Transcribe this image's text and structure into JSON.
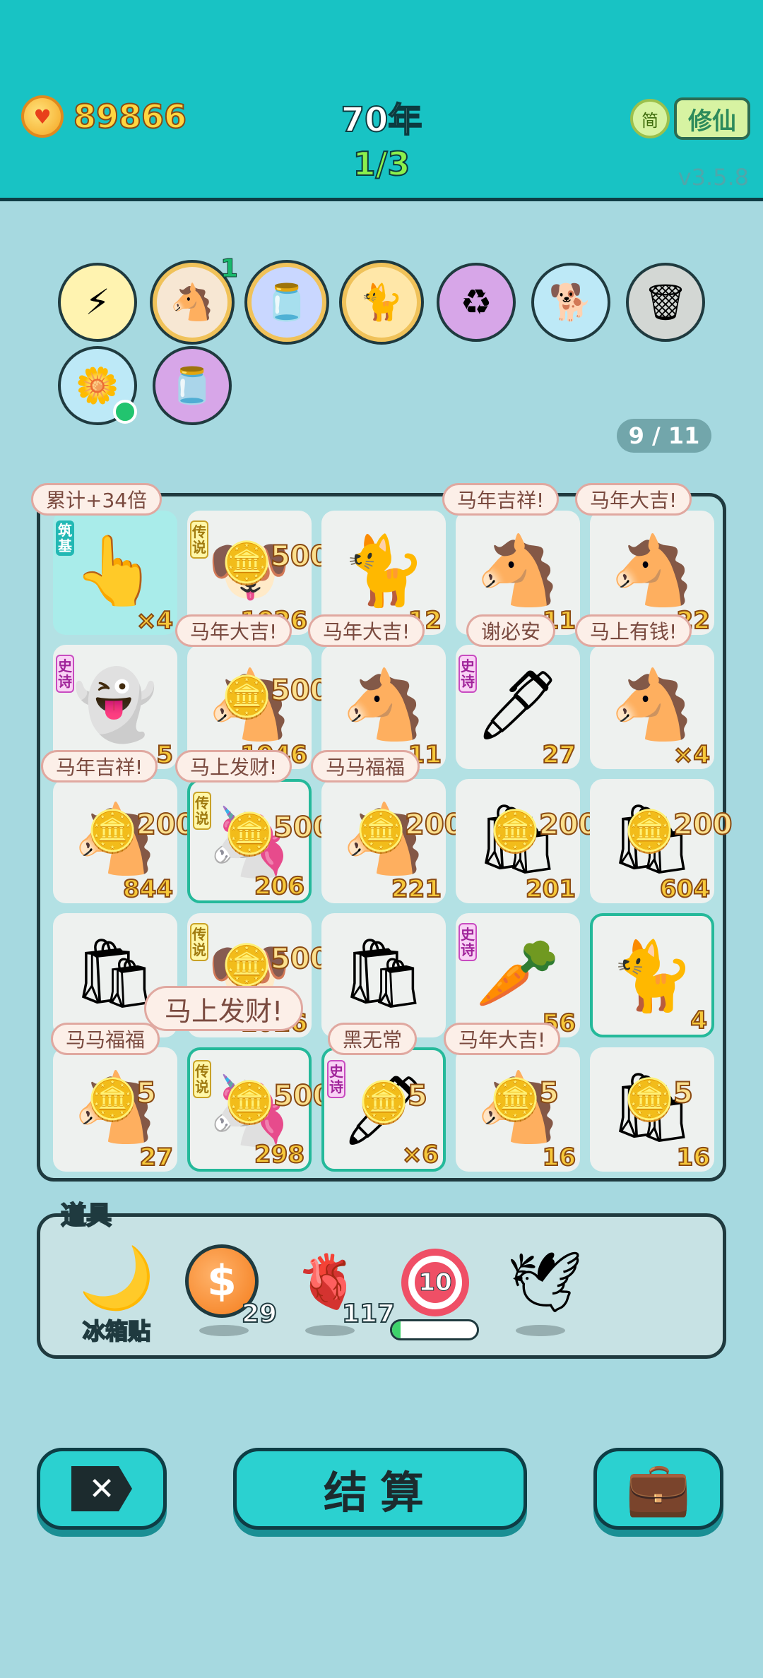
{
  "header": {
    "coins": "89866",
    "year": "70年",
    "progress": "1/3",
    "lang_button": "简",
    "mode_button": "修仙",
    "version": "v3.5.8"
  },
  "buffs": {
    "items": [
      {
        "icon": "lightning-icon",
        "glyph": "⚡",
        "bg": "#fff3b0"
      },
      {
        "icon": "horse-pair-icon",
        "glyph": "🐴",
        "bg": "#f7e7d3",
        "count": "1"
      },
      {
        "icon": "jar-icon",
        "glyph": "🫙",
        "bg": "#c9d7ff"
      },
      {
        "icon": "cat-icon",
        "glyph": "🐈",
        "bg": "#ffe7a8"
      },
      {
        "icon": "recycle-icon",
        "glyph": "♻",
        "bg": "#d7a6e8"
      },
      {
        "icon": "dog-icon",
        "glyph": "🐕",
        "bg": "#bde9f7"
      },
      {
        "icon": "trash-bag-recycle-icon",
        "glyph": "🗑",
        "bg": "#d3d7d4"
      },
      {
        "icon": "potted-flower-icon",
        "glyph": "🌼",
        "bg": "#bde9f7"
      },
      {
        "icon": "jar-icon",
        "glyph": "🫙",
        "bg": "#d7a6e8"
      }
    ]
  },
  "pager": "9 / 11",
  "board": {
    "cells": [
      {
        "glyph": "👆",
        "num": "×4",
        "tag": "筑基",
        "tag_type": "build",
        "cyan": true
      },
      {
        "glyph": "🐶",
        "num": "1026",
        "tag": "传说",
        "tag_type": "legend",
        "ingot": "500"
      },
      {
        "glyph": "🐈",
        "num": "12"
      },
      {
        "glyph": "🐴",
        "num": "11"
      },
      {
        "glyph": "🐴",
        "num": "22"
      },
      {
        "glyph": "👻",
        "num": "5",
        "tag": "史诗",
        "tag_type": "epic"
      },
      {
        "glyph": "🐴",
        "num": "1946",
        "ingot": "500"
      },
      {
        "glyph": "🐴",
        "num": "11"
      },
      {
        "glyph": "🖊",
        "num": "27",
        "tag": "史诗",
        "tag_type": "epic"
      },
      {
        "glyph": "🐴",
        "num": "×4"
      },
      {
        "glyph": "🐴",
        "num": "844",
        "ingot": "200"
      },
      {
        "glyph": "🦄",
        "num": "206",
        "tag": "传说",
        "tag_type": "legend",
        "ingot": "500",
        "hl": true
      },
      {
        "glyph": "🐴",
        "num": "221",
        "ingot": "200"
      },
      {
        "glyph": "🛍",
        "num": "201",
        "ingot": "200"
      },
      {
        "glyph": "🛍",
        "num": "604",
        "ingot": "200"
      },
      {
        "glyph": "🛍",
        "num": ""
      },
      {
        "glyph": "🐶",
        "num": "1026",
        "tag": "传说",
        "tag_type": "legend",
        "ingot": "500"
      },
      {
        "glyph": "🛍",
        "num": ""
      },
      {
        "glyph": "🥕",
        "num": "56",
        "tag": "史诗",
        "tag_type": "epic"
      },
      {
        "glyph": "🐈",
        "num": "4",
        "hl": true
      },
      {
        "glyph": "🐴",
        "num": "27",
        "ingot": "5"
      },
      {
        "glyph": "🦄",
        "num": "298",
        "tag": "传说",
        "tag_type": "legend",
        "ingot": "500",
        "hl": true
      },
      {
        "glyph": "🖊",
        "num": "×6",
        "tag": "史诗",
        "tag_type": "epic",
        "ingot": "5",
        "hl": true
      },
      {
        "glyph": "🐴",
        "num": "16",
        "ingot": "5"
      },
      {
        "glyph": "🛍",
        "num": "16",
        "ingot": "5"
      }
    ],
    "bubbles": [
      "累计+34倍",
      "马年吉祥!",
      "马年大吉!",
      "马年大吉!",
      "马年大吉!",
      "谢必安",
      "马上有钱!",
      "马年吉祥!",
      "马上发财!",
      "马马福福",
      "马上发财!",
      "马马福福",
      "黑无常",
      "马年大吉!"
    ]
  },
  "props": {
    "title": "道具",
    "fridge_magnet": {
      "glyph": "🌙",
      "label": "冰箱贴"
    },
    "coin": {
      "glyph": "$",
      "count": "29"
    },
    "liver": {
      "glyph": "🫀",
      "count": "117"
    },
    "target": {
      "value": "10",
      "timer_fraction": 0.1
    },
    "goose": {
      "glyph": "🕊"
    }
  },
  "buttons": {
    "close": "✕",
    "settle": "结算",
    "bag": "💼"
  },
  "colors": {
    "header_bg": "#18c3c4",
    "page_bg": "#a6d9e0",
    "button_bg": "#2bd1d0",
    "number_gold": "#f6c83a"
  }
}
